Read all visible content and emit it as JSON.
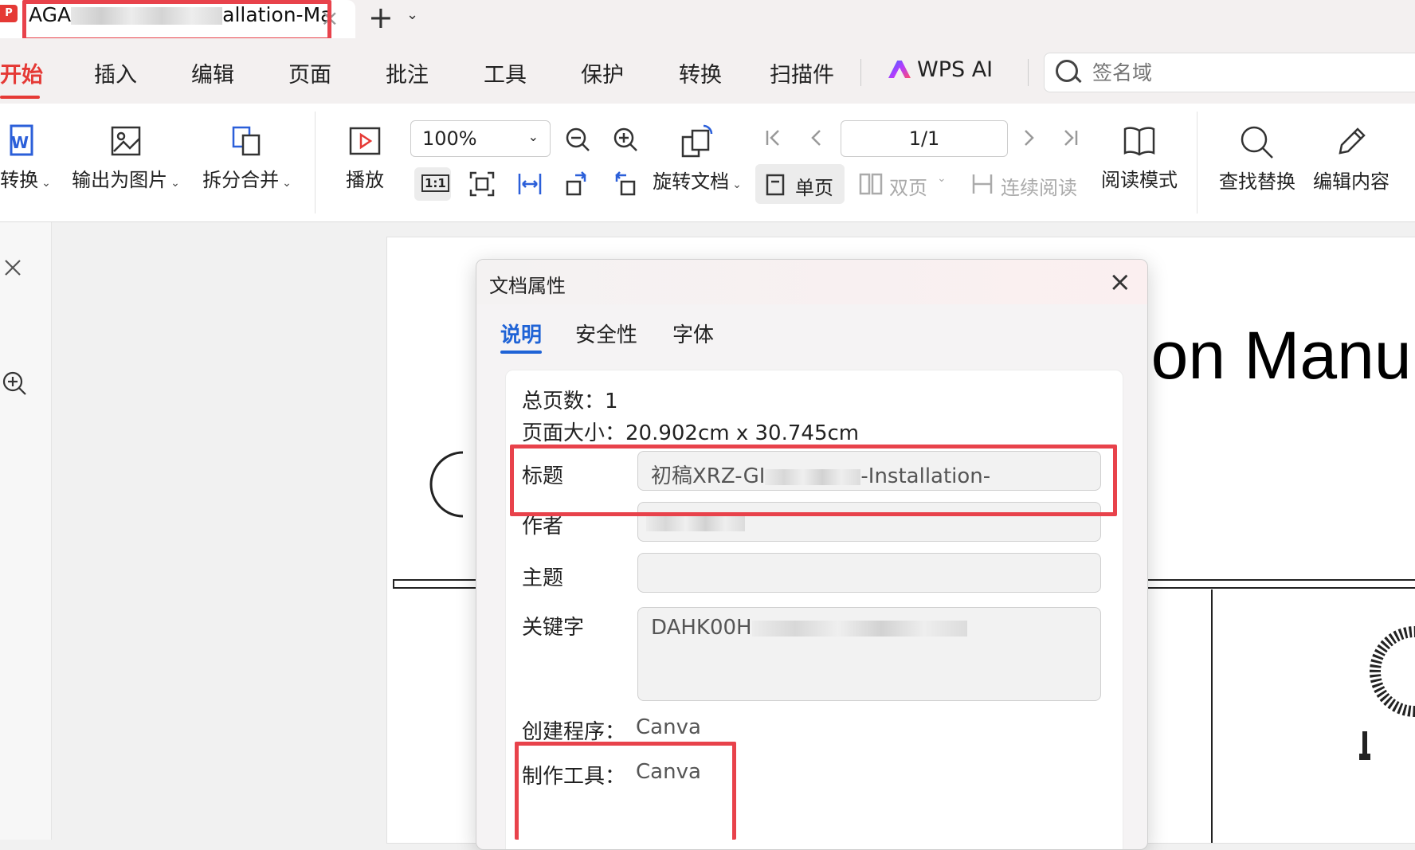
{
  "tab": {
    "app_logo": "P",
    "title_prefix": "AGA",
    "title_suffix": "allation-Ma",
    "close_icon": "×",
    "new_tab_icon": "+",
    "more_icon": "⌄"
  },
  "menu": {
    "items": [
      "开始",
      "插入",
      "编辑",
      "页面",
      "批注",
      "工具",
      "保护",
      "转换",
      "扫描件"
    ],
    "ai_label": "WPS AI",
    "search_placeholder": "签名域"
  },
  "toolbar": {
    "to_word": "转换",
    "export_image": "输出为图片",
    "split_merge": "拆分合并",
    "play": "播放",
    "zoom": "100%",
    "actual_size": "1:1",
    "rotate_doc": "旋转文档",
    "single_page": "单页",
    "double_page": "双页",
    "continuous": "连续阅读",
    "page_indicator": "1/1",
    "read_mode": "阅读模式",
    "find_replace": "查找替换",
    "edit_content": "编辑内容"
  },
  "document": {
    "heading_fragment": "ion Manu"
  },
  "dialog": {
    "title": "文档属性",
    "tabs": [
      "说明",
      "安全性",
      "字体"
    ],
    "total_pages": "总页数：1",
    "page_size": "页面大小：20.902cm x 30.745cm",
    "fields": {
      "title_label": "标题",
      "title_prefix": "初稿XRZ-GI",
      "title_suffix": "-Installation-",
      "author_label": "作者",
      "subject_label": "主题",
      "keywords_label": "关键字",
      "keywords_prefix": "DAHK00H"
    },
    "creator_label": "创建程序：",
    "creator_value": "Canva",
    "producer_label": "制作工具：",
    "producer_value": "Canva"
  },
  "colors": {
    "accent_red": "#e53935",
    "highlight_red": "#e8424b",
    "tab_blue": "#1f63d6"
  }
}
